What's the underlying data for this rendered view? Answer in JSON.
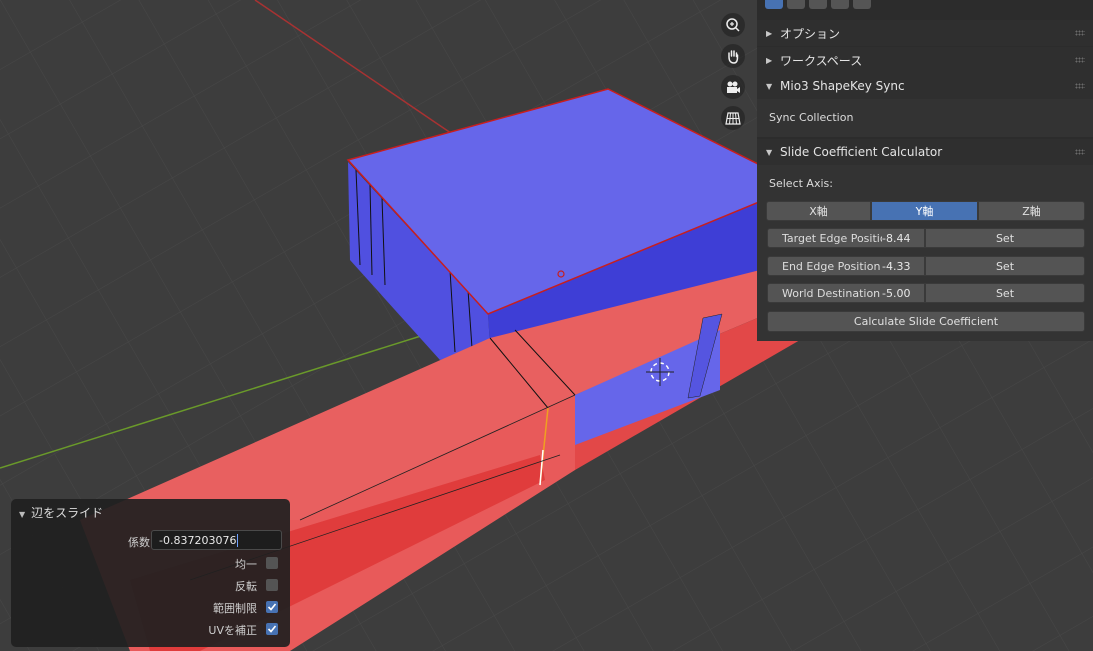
{
  "colors": {
    "accent": "#4772b3",
    "face_blue": "#6666e8",
    "face_red": "#e86060",
    "axis_green": "#6a9a2a",
    "axis_red": "#b03030"
  },
  "viewport_tools": [
    {
      "name": "zoom",
      "icon": "zoom-in-icon"
    },
    {
      "name": "pan",
      "icon": "hand-icon"
    },
    {
      "name": "camera",
      "icon": "camera-icon"
    },
    {
      "name": "ortho",
      "icon": "grid-icon"
    }
  ],
  "sidebar": {
    "panels": {
      "options": "オプション",
      "workspace": "ワークスペース",
      "shapekey_sync": "Mio3 ShapeKey Sync",
      "sync_collection": "Sync Collection",
      "slide_calc": "Slide Coefficient Calculator"
    },
    "select_axis_label": "Select Axis:",
    "axes": [
      "X軸",
      "Y軸",
      "Z軸"
    ],
    "active_axis": "Y軸",
    "fields": [
      {
        "label": "Target Edge Positio",
        "value": "-8.44",
        "button": "Set"
      },
      {
        "label": "End Edge Position",
        "value": "-4.33",
        "button": "Set"
      },
      {
        "label": "World Destination",
        "value": "-5.00",
        "button": "Set"
      }
    ],
    "calculate_label": "Calculate Slide Coefficient"
  },
  "redo_panel": {
    "title": "辺をスライド",
    "factor_label": "係数",
    "factor_value": "-0.837203076",
    "even_label": "均一",
    "even_checked": false,
    "flip_label": "反転",
    "flip_checked": false,
    "clamp_label": "範囲制限",
    "clamp_checked": true,
    "uv_label": "UVを補正",
    "uv_checked": true
  }
}
